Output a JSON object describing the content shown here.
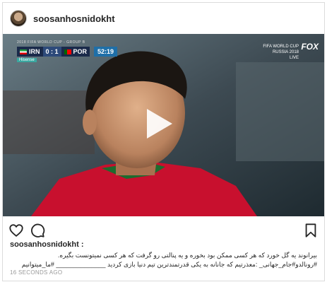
{
  "post": {
    "username": "soosanhosnidokht",
    "caption_user": "soosanhosnidokht :",
    "caption_text": "بیرانوند یه گل خورد که هر کسی ممکن بود بخوره و یه پنالتی رو گرفت که هر کسی نمیتونست بگیره. #رونالدو#جام_جهانی_ :معذرتیم که جانانه به یکی قدرتمندترین تیم دنیا بازی کردید ______________ #ما_میتوانیم",
    "timestamp": "16 SECONDS AGO"
  },
  "broadcast": {
    "title": "2018 FIFA WORLD CUP - GROUP B",
    "home_team": "IRN",
    "away_team": "POR",
    "score": "0 : 1",
    "clock": "52:19",
    "sponsor": "Hisense",
    "brand_line1": "FIFA WORLD CUP",
    "brand_line2": "RUSSIA 2018",
    "brand_line3": "LIVE",
    "network": "FOX"
  },
  "icons": {
    "avatar": "profile-avatar",
    "play": "play-icon",
    "like": "heart-icon",
    "comment": "comment-icon",
    "save": "bookmark-icon"
  }
}
